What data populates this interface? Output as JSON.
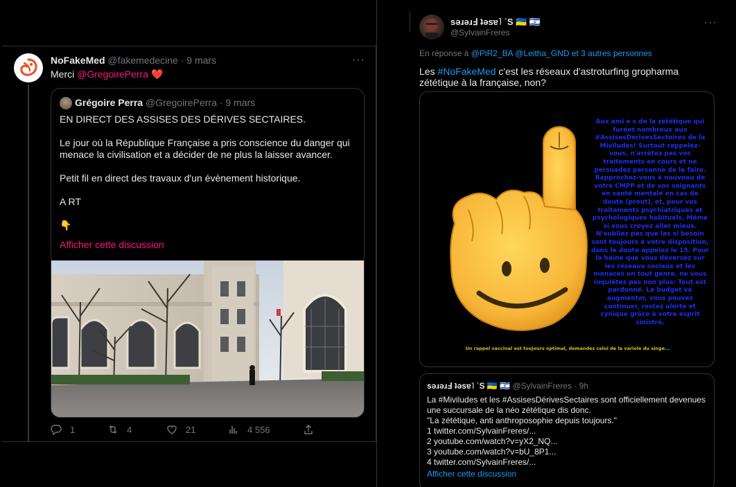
{
  "left_tweet": {
    "display_name": "NoFakeMed",
    "handle": "@fakemedecine",
    "time": "· 9 mars",
    "more": "···",
    "text_prefix": "Merci ",
    "mention": "@GregoirePerra",
    "heart": "❤️",
    "quote": {
      "display_name": "Grégoire Perra",
      "handle": "@GregoirePerra",
      "time": "· 9 mars",
      "para1": "EN DIRECT DES ASSISES DES DÉRIVES SECTAIRES.",
      "para2": "Le jour où la République Française a pris conscience du danger qui menace la civilisation et a décider de ne plus la laisser avancer.",
      "para3": "Petit fil en direct des travaux d'un évènement historique.",
      "para4": "A RT",
      "emoji": "👇",
      "show_thread": "Afficher cette discussion"
    },
    "actions": {
      "replies": "1",
      "retweets": "4",
      "likes": "21",
      "views": "4 556"
    }
  },
  "right_tweet": {
    "display_name": "sǝɹǝɹℲ ʇǝsɐ˥ ˙S 🇺🇦 🇮🇱",
    "handle": "@SylvainFreres",
    "more": "···",
    "reply_label": "En réponse à ",
    "reply_mentions": "@PiR2_BA @Leitha_GND",
    "reply_suffix": " et 3 autres personnes",
    "text_prefix": "Les ",
    "hashtag": "#NoFakeMed",
    "text_suffix": " c'est les réseaux d'astroturfing gropharma zététique à la française, non?",
    "meme": {
      "text": "Aux ami e s de la zététique qui furent nombreux aux #AssisesDérivesSectoires de la Miviludes! Surtout rappelez-vous, n'arrêtez pas vos traitements en cours et ne persuadez personne de le faire. Rapprochez-vous à nouveau de votre CMPP et de vos soignants en santé mentale en cas de doute (prout), et, pour vos traitements psychiatriques et psychologiques habituels. Même si vous croyez aller mieux. N'oubliez pas que les si besoin sont toujours à votre disposition, dans le doute appelez le 15. Pour la haine que vous déversez sur les réseaux sociaux et les menaces en tout genre, ne vous inquiétez pas non plus: Tout est pardonné. Le budget va augmenter, vous pouvez continuer, restez alerte et cynique grâce à votre esprit sinistré.",
      "caption": "Un rappel vaccinal est toujours optimal, demandez celui de la variole du singe..."
    },
    "quote": {
      "display_name": "sǝɹǝɹℲ ʇǝsɐ˥ ˙S 🇺🇦 🇮🇱",
      "handle": "@SylvainFreres",
      "time": "· 9h",
      "line1": "La #Miviludes et les #AssisesDérivesSectaires sont officiellement devenues une succursale de la néo zététique dis donc.",
      "line2": "\"La zététique, anti anthroposophie depuis toujours.\"",
      "line3": "1 twitter.com/SylvainFreres/...",
      "line4": "2 youtube.com/watch?v=yX2_NQ...",
      "line5": "3 youtube.com/watch?v=bU_8P1...",
      "line6": "4 twitter.com/SylvainFreres/...",
      "show_thread": "Afficher cette discussion"
    }
  },
  "colors": {
    "background": "#000000",
    "text": "#e7e9ea",
    "muted": "#71767b",
    "pink_accent": "#f91880",
    "blue_accent": "#1d9bf0",
    "border": "#2f3336",
    "meme_text": "#1c2fe8",
    "meme_caption": "#d4c21a"
  },
  "icons": [
    "reply-icon",
    "retweet-icon",
    "like-icon",
    "views-icon",
    "share-icon",
    "more-icon"
  ]
}
